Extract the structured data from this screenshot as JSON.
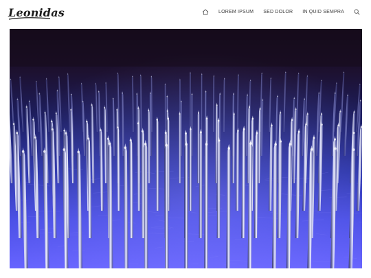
{
  "header": {
    "logo_text": "Leonidas",
    "nav": [
      {
        "icon": "home-icon"
      },
      {
        "label": "LOREM IPSUM"
      },
      {
        "label": "SED DOLOR"
      },
      {
        "label": "IN QUID SEMPRA"
      },
      {
        "icon": "search-icon"
      }
    ]
  },
  "hero": {
    "image": "close-up photo of rows of metal pins on a blue-lit surface"
  },
  "colors": {
    "nav_text": "#3a3a3a",
    "logo": "#1b1b1b",
    "hero_light": "#5a55ff"
  }
}
